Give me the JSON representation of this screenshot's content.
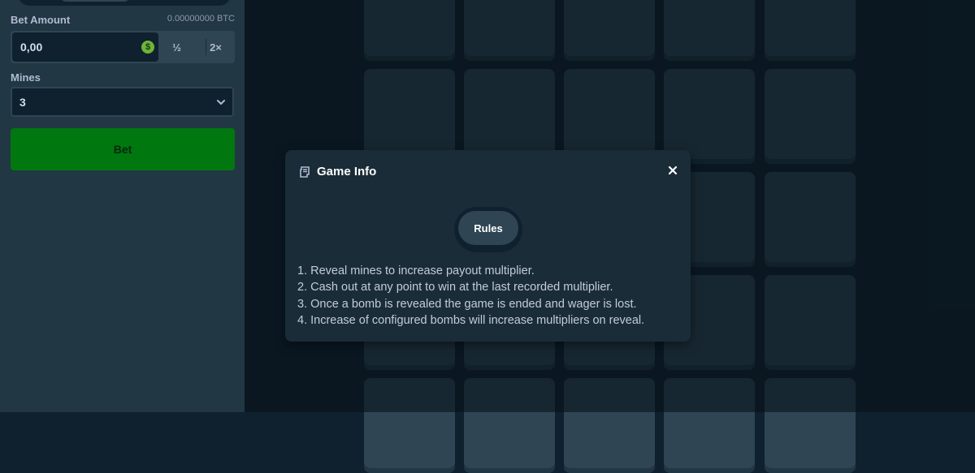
{
  "sidebar": {
    "bet_amount_label": "Bet Amount",
    "balance_text": "0.00000000 BTC",
    "bet_amount_value": "0,00",
    "currency_symbol": "$",
    "half_label": "½",
    "double_label": "2×",
    "mines_label": "Mines",
    "mines_value": "3",
    "bet_button_label": "Bet"
  },
  "modal": {
    "title": "Game Info",
    "tab_label": "Rules",
    "rules": [
      "1. Reveal mines to increase payout multiplier.",
      "2. Cash out at any point to win at the last recorded multiplier.",
      "3. Once a bomb is revealed the game is ended and wager is lost.",
      "4. Increase of configured bombs will increase multipliers on reveal."
    ]
  },
  "colors": {
    "accent_green": "#00770f",
    "coin_green": "#6fb33a",
    "background": "#0f212e",
    "panel": "#213743",
    "tile": "#2f4553"
  },
  "icons": {
    "coin": "dollar-coin-icon",
    "select": "chevron-down-icon",
    "modal_title": "receipt-icon",
    "close": "close-icon"
  }
}
